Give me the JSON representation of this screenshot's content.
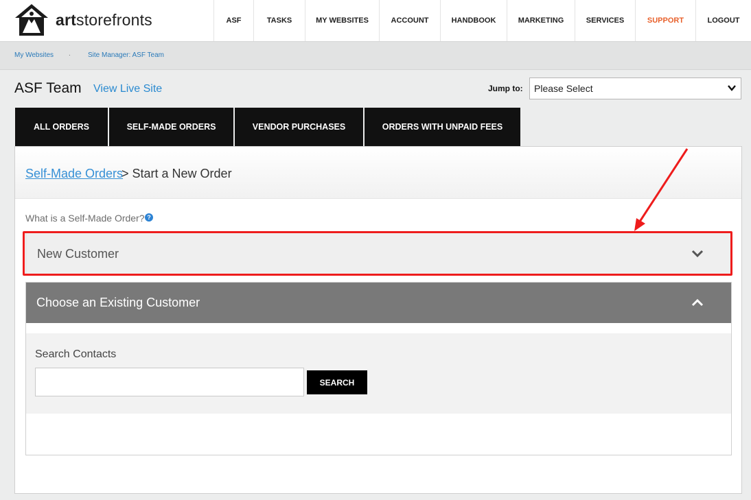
{
  "brand": {
    "name_bold": "art",
    "name_rest": "storefronts",
    "accent": "#e8612c"
  },
  "nav": {
    "items": [
      {
        "label": "ASF"
      },
      {
        "label": "TASKS"
      },
      {
        "label": "MY WEBSITES"
      },
      {
        "label": "ACCOUNT"
      },
      {
        "label": "HANDBOOK"
      },
      {
        "label": "MARKETING"
      },
      {
        "label": "SERVICES"
      },
      {
        "label": "SUPPORT"
      },
      {
        "label": "LOGOUT"
      }
    ]
  },
  "breadcrumb": {
    "items": [
      "My Websites",
      "Site Manager: ASF Team"
    ],
    "separator": "."
  },
  "site": {
    "title": "ASF Team",
    "view_live": "View Live Site"
  },
  "jump": {
    "label": "Jump to:",
    "selected": "Please Select"
  },
  "tabs": [
    {
      "label": "ALL ORDERS"
    },
    {
      "label": "SELF-MADE ORDERS"
    },
    {
      "label": "VENDOR PURCHASES"
    },
    {
      "label": "ORDERS WITH UNPAID FEES"
    }
  ],
  "panel": {
    "breadcrumb_link": "Self-Made Orders",
    "breadcrumb_rest": "> Start a New Order",
    "what_is": "What is a Self-Made Order?",
    "help_icon": "question-circle-icon",
    "new_customer": {
      "label": "New Customer",
      "icon": "chevron-down-icon"
    },
    "existing_customer": {
      "label": "Choose an Existing Customer",
      "icon": "chevron-up-icon",
      "search_label": "Search Contacts",
      "search_value": "",
      "search_button": "SEARCH"
    }
  },
  "annotation": {
    "color": "#ee1c1c"
  }
}
